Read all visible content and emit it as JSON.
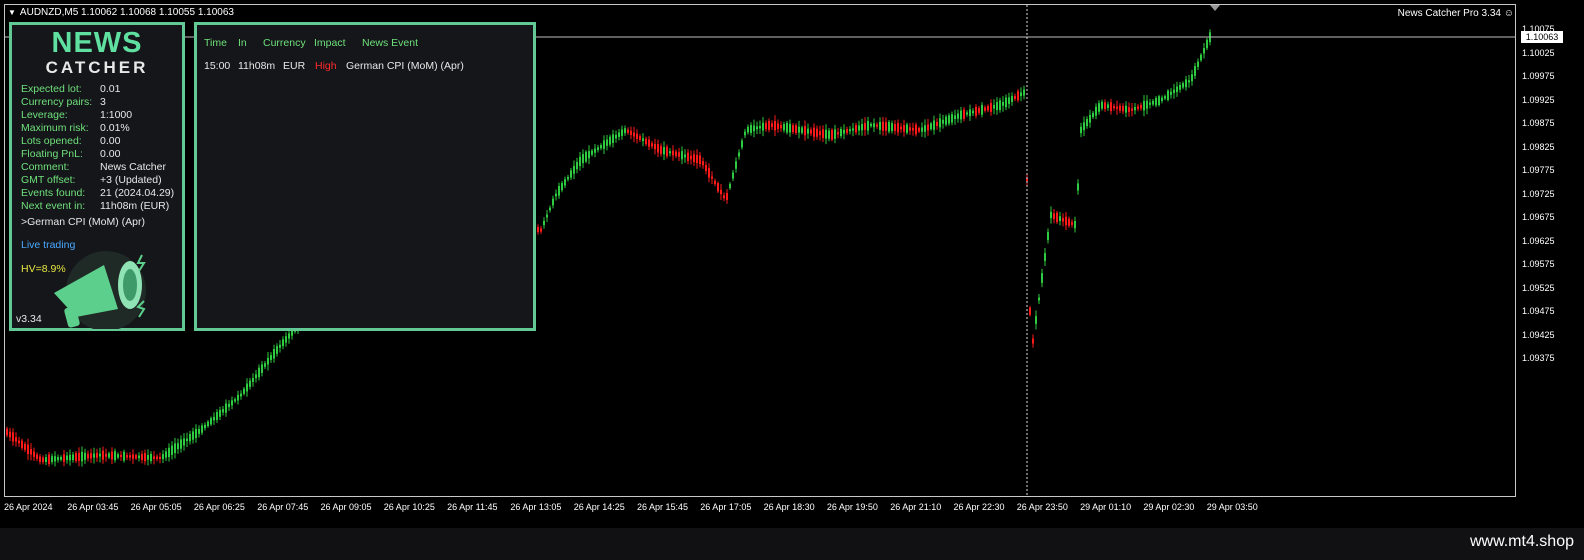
{
  "chart": {
    "symbol_line": "AUDNZD,M5  1.10062 1.10068 1.10055 1.10063",
    "indicator_label": "News Catcher Pro 3.34",
    "current_price": "1.10063",
    "price_labels": [
      "1.10075",
      "1.10025",
      "1.09975",
      "1.09925",
      "1.09875",
      "1.09825",
      "1.09775",
      "1.09725",
      "1.09675",
      "1.09625",
      "1.09575",
      "1.09525",
      "1.09475",
      "1.09425",
      "1.09375"
    ],
    "time_labels": [
      "26 Apr 2024",
      "26 Apr 03:45",
      "26 Apr 05:05",
      "26 Apr 06:25",
      "26 Apr 07:45",
      "26 Apr 09:05",
      "26 Apr 10:25",
      "26 Apr 11:45",
      "26 Apr 13:05",
      "26 Apr 14:25",
      "26 Apr 15:45",
      "26 Apr 17:05",
      "26 Apr 18:30",
      "26 Apr 19:50",
      "26 Apr 21:10",
      "26 Apr 22:30",
      "26 Apr 23:50",
      "29 Apr 01:10",
      "29 Apr 02:30",
      "29 Apr 03:50"
    ],
    "colors": {
      "bull": "#2ecc40",
      "bear": "#ff1a1a",
      "background": "#000000",
      "panel_border": "#62c894"
    }
  },
  "info_panel": {
    "logo_top": "NEWS",
    "logo_bottom": "CATCHER",
    "rows": [
      {
        "label": "Expected lot:",
        "value": "0.01"
      },
      {
        "label": "Currency pairs:",
        "value": "3"
      },
      {
        "label": "Leverage:",
        "value": "1:1000"
      },
      {
        "label": "Maximum risk:",
        "value": "0.01%"
      },
      {
        "label": "Lots opened:",
        "value": "0.00"
      },
      {
        "label": "Floating PnL:",
        "value": "0.00"
      },
      {
        "label": "Comment:",
        "value": "News Catcher"
      },
      {
        "label": "GMT offset:",
        "value": "+3 (Updated)"
      },
      {
        "label": "Events found:",
        "value": "21 (2024.04.29)"
      },
      {
        "label": "Next event in:",
        "value": "11h08m (EUR)"
      }
    ],
    "next_event": ">German CPI (MoM) (Apr)",
    "mode": "Live trading",
    "hv": "HV=8.9%",
    "version": "v3.34",
    "icon": "megaphone-icon"
  },
  "events_panel": {
    "headers": [
      "Time",
      "In",
      "Currency",
      "Impact",
      "News Event"
    ],
    "rows": [
      {
        "time": "15:00",
        "in": "11h08m",
        "currency": "EUR",
        "impact": "High",
        "event": "German CPI (MoM) (Apr)"
      }
    ]
  },
  "footer": {
    "watermark": "www.mt4.shop"
  }
}
